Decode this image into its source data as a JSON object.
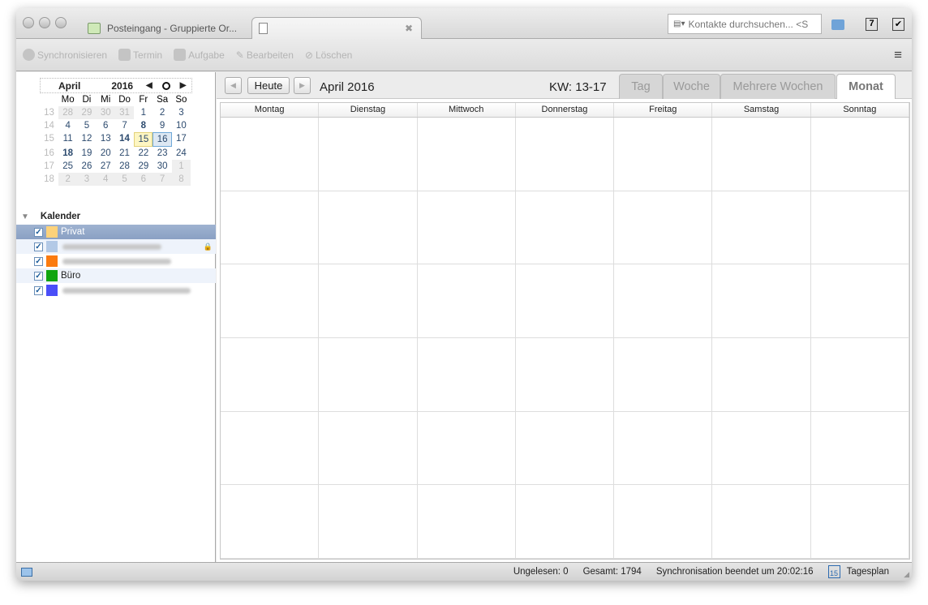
{
  "tabs": [
    {
      "label": "Posteingang - Gruppierte Or..."
    },
    {
      "label": ""
    }
  ],
  "search": {
    "placeholder": "Kontakte durchsuchen... <S"
  },
  "toolbar": {
    "sync": "Synchronisieren",
    "termin": "Termin",
    "aufgabe": "Aufgabe",
    "bearbeiten": "Bearbeiten",
    "loeschen": "Löschen"
  },
  "minical": {
    "month": "April",
    "year": "2016",
    "weekdays": [
      "Mo",
      "Di",
      "Mi",
      "Do",
      "Fr",
      "Sa",
      "So"
    ],
    "weeks": [
      {
        "wk": "13",
        "days": [
          [
            "28",
            "o"
          ],
          [
            "29",
            "o"
          ],
          [
            "30",
            "o"
          ],
          [
            "31",
            "o"
          ],
          [
            "1",
            ""
          ],
          [
            "2",
            ""
          ],
          [
            "3",
            ""
          ]
        ]
      },
      {
        "wk": "14",
        "days": [
          [
            "4",
            ""
          ],
          [
            "5",
            ""
          ],
          [
            "6",
            ""
          ],
          [
            "7",
            ""
          ],
          [
            "8",
            "b"
          ],
          [
            "9",
            ""
          ],
          [
            "10",
            ""
          ]
        ]
      },
      {
        "wk": "15",
        "days": [
          [
            "11",
            ""
          ],
          [
            "12",
            ""
          ],
          [
            "13",
            ""
          ],
          [
            "14",
            "b"
          ],
          [
            "15",
            "t"
          ],
          [
            "16",
            "s"
          ],
          [
            "17",
            ""
          ]
        ]
      },
      {
        "wk": "16",
        "days": [
          [
            "18",
            "b"
          ],
          [
            "19",
            ""
          ],
          [
            "20",
            ""
          ],
          [
            "21",
            ""
          ],
          [
            "22",
            ""
          ],
          [
            "23",
            ""
          ],
          [
            "24",
            ""
          ]
        ]
      },
      {
        "wk": "17",
        "days": [
          [
            "25",
            ""
          ],
          [
            "26",
            ""
          ],
          [
            "27",
            ""
          ],
          [
            "28",
            ""
          ],
          [
            "29",
            ""
          ],
          [
            "30",
            ""
          ],
          [
            "1",
            "o"
          ]
        ]
      },
      {
        "wk": "18",
        "days": [
          [
            "2",
            "o"
          ],
          [
            "3",
            "o"
          ],
          [
            "4",
            "o"
          ],
          [
            "5",
            "o"
          ],
          [
            "6",
            "o"
          ],
          [
            "7",
            "o"
          ],
          [
            "8",
            "o"
          ]
        ]
      }
    ]
  },
  "calendars": {
    "heading": "Kalender",
    "items": [
      {
        "name": "Privat",
        "color": "#fdd27a",
        "state": "sel"
      },
      {
        "name": "",
        "color": "#b3c9e6",
        "state": "alt",
        "locked": true
      },
      {
        "name": "",
        "color": "#fb7b10",
        "state": ""
      },
      {
        "name": "Büro",
        "color": "#10a510",
        "state": "alt"
      },
      {
        "name": "",
        "color": "#4a4ef8",
        "state": ""
      }
    ]
  },
  "nav": {
    "today": "Heute",
    "title": "April 2016",
    "kw": "KW: 13-17"
  },
  "views": [
    "Tag",
    "Woche",
    "Mehrere Wochen",
    "Monat"
  ],
  "weekdays": [
    "Montag",
    "Dienstag",
    "Mittwoch",
    "Donnerstag",
    "Freitag",
    "Samstag",
    "Sonntag"
  ],
  "status": {
    "unread": "Ungelesen: 0",
    "total": "Gesamt: 1794",
    "sync": "Synchronisation beendet um 20:02:16",
    "dayplan": "Tagesplan",
    "dayplan_icon_num": "15"
  }
}
